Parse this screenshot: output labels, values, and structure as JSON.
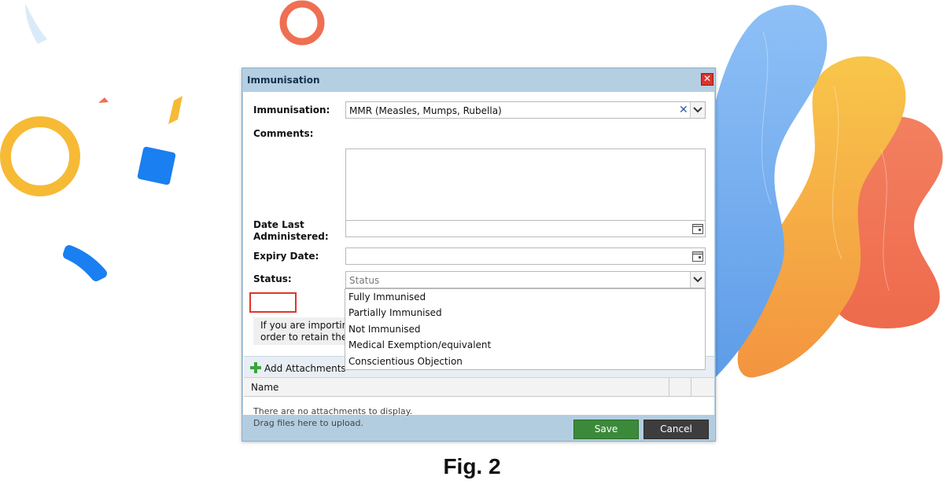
{
  "dialog": {
    "title": "Immunisation",
    "close_glyph": "✕"
  },
  "form": {
    "immunisation": {
      "label": "Immunisation:",
      "value": "MMR (Measles, Mumps, Rubella)"
    },
    "comments": {
      "label": "Comments:",
      "value": ""
    },
    "date_last_administered": {
      "label_line1": "Date Last",
      "label_line2": "Administered:",
      "value": ""
    },
    "expiry_date": {
      "label": "Expiry Date:",
      "value": ""
    },
    "status": {
      "label": "Status:",
      "placeholder": "Status"
    }
  },
  "info": {
    "line1": "If you are importin",
    "line2": "order to retain the:"
  },
  "status_options": [
    "Fully Immunised",
    "Partially Immunised",
    "Not Immunised",
    "Medical Exemption/equivalent",
    "Conscientious Objection"
  ],
  "attachments": {
    "add_label": "Add Attachments",
    "column_name": "Name",
    "empty_line1": "There are no attachments to display.",
    "empty_line2": "Drag files here to upload."
  },
  "buttons": {
    "save": "Save",
    "cancel": "Cancel"
  },
  "caption": "Fig. 2",
  "colors": {
    "save": "#3b8a3b",
    "cancel": "#3d3d3d",
    "highlight": "#e0352b",
    "blob_blue": "#74aef0",
    "blob_yellow": "#f7b93c",
    "blob_orange": "#f0765a"
  },
  "icons": {
    "close": "close-icon",
    "clear": "clear-x-icon",
    "dropdown": "chevron-down-icon",
    "calendar": "calendar-icon",
    "add": "plus-icon"
  }
}
